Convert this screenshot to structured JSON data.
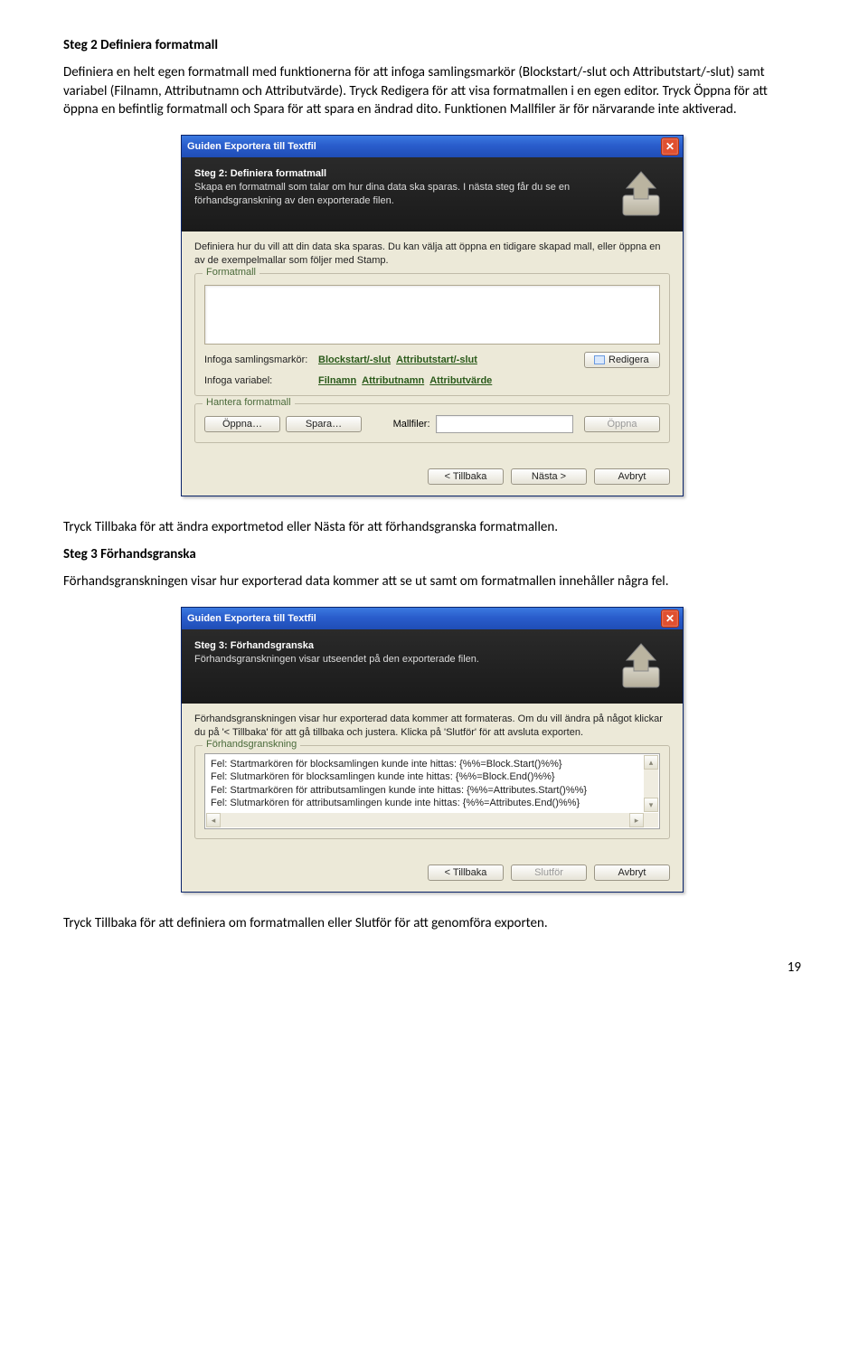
{
  "step2": {
    "heading": "Steg 2 Definiera formatmall",
    "para": "Definiera en helt egen formatmall med funktionerna för att infoga samlingsmarkör (Blockstart/-slut och Attributstart/-slut) samt variabel (Filnamn, Attributnamn och Attributvärde). Tryck Redigera för att visa formatmallen i en egen editor. Tryck Öppna för att öppna en befintlig formatmall och Spara för att spara en ändrad dito. Funktionen Mallfiler är för närvarande inte aktiverad."
  },
  "dialog1": {
    "title": "Guiden Exportera till Textfil",
    "banner_title": "Steg 2: Definiera formatmall",
    "banner_desc": "Skapa en formatmall som talar om hur dina data ska sparas. I nästa steg får du se en förhandsgranskning av den exporterade filen.",
    "body_desc": "Definiera hur du vill att din data ska sparas. Du kan välja att öppna en tidigare skapad mall, eller öppna en av de exempelmallar som följer med Stamp.",
    "legend_formatmall": "Formatmall",
    "row1_label": "Infoga samlingsmarkör:",
    "row1_link1": "Blockstart/-slut",
    "row1_link2": "Attributstart/-slut",
    "row2_label": "Infoga variabel:",
    "row2_link1": "Filnamn",
    "row2_link2": "Attributnamn",
    "row2_link3": "Attributvärde",
    "redigera": "Redigera",
    "legend_hantera": "Hantera formatmall",
    "oppna": "Öppna…",
    "spara": "Spara…",
    "mallfiler_label": "Mallfiler:",
    "oppna2": "Öppna",
    "back": "< Tillbaka",
    "next": "Nästa >",
    "cancel": "Avbryt"
  },
  "between1": "Tryck Tillbaka för att ändra exportmetod eller Nästa för att förhandsgranska formatmallen.",
  "step3": {
    "heading": "Steg 3 Förhandsgranska",
    "para": "Förhandsgranskningen visar hur exporterad data kommer att se ut samt om formatmallen innehåller några fel."
  },
  "dialog2": {
    "title": "Guiden Exportera till Textfil",
    "banner_title": "Steg 3: Förhandsgranska",
    "banner_desc": "Förhandsgranskningen visar utseendet på den exporterade filen.",
    "body_desc": "Förhandsgranskningen visar hur exporterad data kommer att formateras. Om du vill ändra på något klickar du på '< Tillbaka' för att gå tillbaka och justera. Klicka på 'Slutför' för att avsluta exporten.",
    "legend_preview": "Förhandsgranskning",
    "line1": "Fel: Startmarkören för blocksamlingen kunde inte hittas: {%%=Block.Start()%%}",
    "line2": "Fel: Slutmarkören för blocksamlingen kunde inte hittas: {%%=Block.End()%%}",
    "line3": "Fel: Startmarkören för attributsamlingen kunde inte hittas: {%%=Attributes.Start()%%}",
    "line4": "Fel: Slutmarkören för attributsamlingen kunde inte hittas: {%%=Attributes.End()%%}",
    "back": "< Tillbaka",
    "finish": "Slutför",
    "cancel": "Avbryt"
  },
  "closing": "Tryck Tillbaka för att definiera om formatmallen eller Slutför för att genomföra exporten.",
  "page_number": "19"
}
